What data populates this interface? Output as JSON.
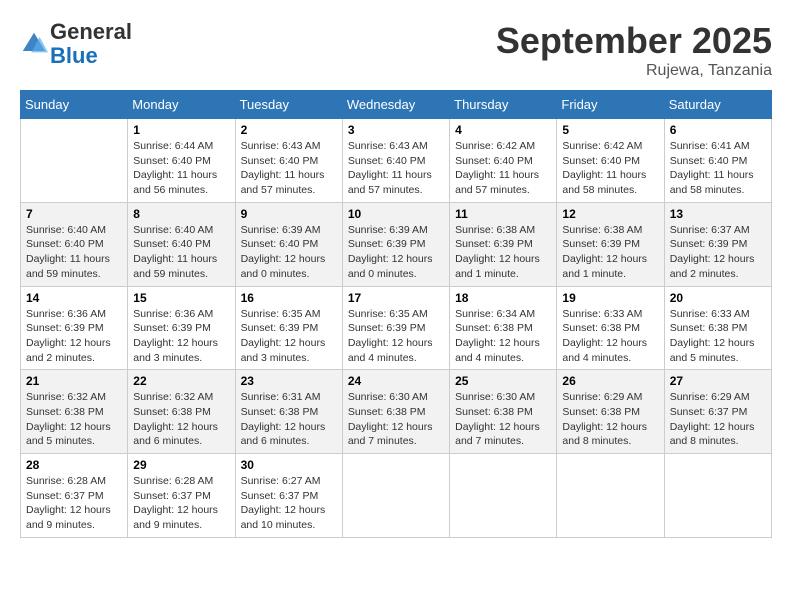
{
  "header": {
    "logo_general": "General",
    "logo_blue": "Blue",
    "month_title": "September 2025",
    "location": "Rujewa, Tanzania"
  },
  "days_of_week": [
    "Sunday",
    "Monday",
    "Tuesday",
    "Wednesday",
    "Thursday",
    "Friday",
    "Saturday"
  ],
  "weeks": [
    [
      {
        "day": "",
        "info": ""
      },
      {
        "day": "1",
        "info": "Sunrise: 6:44 AM\nSunset: 6:40 PM\nDaylight: 11 hours\nand 56 minutes."
      },
      {
        "day": "2",
        "info": "Sunrise: 6:43 AM\nSunset: 6:40 PM\nDaylight: 11 hours\nand 57 minutes."
      },
      {
        "day": "3",
        "info": "Sunrise: 6:43 AM\nSunset: 6:40 PM\nDaylight: 11 hours\nand 57 minutes."
      },
      {
        "day": "4",
        "info": "Sunrise: 6:42 AM\nSunset: 6:40 PM\nDaylight: 11 hours\nand 57 minutes."
      },
      {
        "day": "5",
        "info": "Sunrise: 6:42 AM\nSunset: 6:40 PM\nDaylight: 11 hours\nand 58 minutes."
      },
      {
        "day": "6",
        "info": "Sunrise: 6:41 AM\nSunset: 6:40 PM\nDaylight: 11 hours\nand 58 minutes."
      }
    ],
    [
      {
        "day": "7",
        "info": "Sunrise: 6:40 AM\nSunset: 6:40 PM\nDaylight: 11 hours\nand 59 minutes."
      },
      {
        "day": "8",
        "info": "Sunrise: 6:40 AM\nSunset: 6:40 PM\nDaylight: 11 hours\nand 59 minutes."
      },
      {
        "day": "9",
        "info": "Sunrise: 6:39 AM\nSunset: 6:40 PM\nDaylight: 12 hours\nand 0 minutes."
      },
      {
        "day": "10",
        "info": "Sunrise: 6:39 AM\nSunset: 6:39 PM\nDaylight: 12 hours\nand 0 minutes."
      },
      {
        "day": "11",
        "info": "Sunrise: 6:38 AM\nSunset: 6:39 PM\nDaylight: 12 hours\nand 1 minute."
      },
      {
        "day": "12",
        "info": "Sunrise: 6:38 AM\nSunset: 6:39 PM\nDaylight: 12 hours\nand 1 minute."
      },
      {
        "day": "13",
        "info": "Sunrise: 6:37 AM\nSunset: 6:39 PM\nDaylight: 12 hours\nand 2 minutes."
      }
    ],
    [
      {
        "day": "14",
        "info": "Sunrise: 6:36 AM\nSunset: 6:39 PM\nDaylight: 12 hours\nand 2 minutes."
      },
      {
        "day": "15",
        "info": "Sunrise: 6:36 AM\nSunset: 6:39 PM\nDaylight: 12 hours\nand 3 minutes."
      },
      {
        "day": "16",
        "info": "Sunrise: 6:35 AM\nSunset: 6:39 PM\nDaylight: 12 hours\nand 3 minutes."
      },
      {
        "day": "17",
        "info": "Sunrise: 6:35 AM\nSunset: 6:39 PM\nDaylight: 12 hours\nand 4 minutes."
      },
      {
        "day": "18",
        "info": "Sunrise: 6:34 AM\nSunset: 6:38 PM\nDaylight: 12 hours\nand 4 minutes."
      },
      {
        "day": "19",
        "info": "Sunrise: 6:33 AM\nSunset: 6:38 PM\nDaylight: 12 hours\nand 4 minutes."
      },
      {
        "day": "20",
        "info": "Sunrise: 6:33 AM\nSunset: 6:38 PM\nDaylight: 12 hours\nand 5 minutes."
      }
    ],
    [
      {
        "day": "21",
        "info": "Sunrise: 6:32 AM\nSunset: 6:38 PM\nDaylight: 12 hours\nand 5 minutes."
      },
      {
        "day": "22",
        "info": "Sunrise: 6:32 AM\nSunset: 6:38 PM\nDaylight: 12 hours\nand 6 minutes."
      },
      {
        "day": "23",
        "info": "Sunrise: 6:31 AM\nSunset: 6:38 PM\nDaylight: 12 hours\nand 6 minutes."
      },
      {
        "day": "24",
        "info": "Sunrise: 6:30 AM\nSunset: 6:38 PM\nDaylight: 12 hours\nand 7 minutes."
      },
      {
        "day": "25",
        "info": "Sunrise: 6:30 AM\nSunset: 6:38 PM\nDaylight: 12 hours\nand 7 minutes."
      },
      {
        "day": "26",
        "info": "Sunrise: 6:29 AM\nSunset: 6:38 PM\nDaylight: 12 hours\nand 8 minutes."
      },
      {
        "day": "27",
        "info": "Sunrise: 6:29 AM\nSunset: 6:37 PM\nDaylight: 12 hours\nand 8 minutes."
      }
    ],
    [
      {
        "day": "28",
        "info": "Sunrise: 6:28 AM\nSunset: 6:37 PM\nDaylight: 12 hours\nand 9 minutes."
      },
      {
        "day": "29",
        "info": "Sunrise: 6:28 AM\nSunset: 6:37 PM\nDaylight: 12 hours\nand 9 minutes."
      },
      {
        "day": "30",
        "info": "Sunrise: 6:27 AM\nSunset: 6:37 PM\nDaylight: 12 hours\nand 10 minutes."
      },
      {
        "day": "",
        "info": ""
      },
      {
        "day": "",
        "info": ""
      },
      {
        "day": "",
        "info": ""
      },
      {
        "day": "",
        "info": ""
      }
    ]
  ]
}
